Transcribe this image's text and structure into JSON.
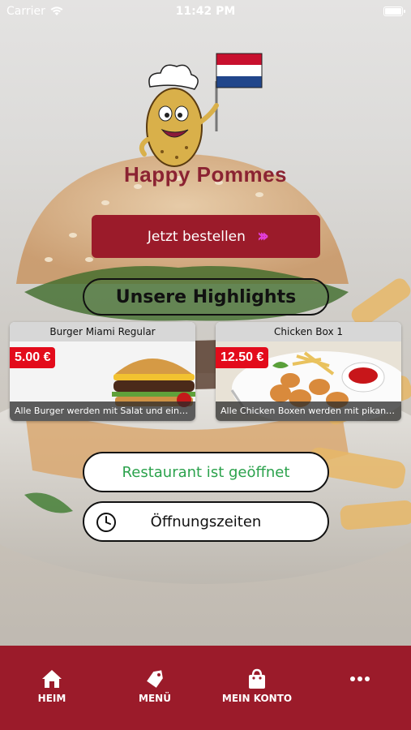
{
  "status_bar": {
    "carrier": "Carrier",
    "time": "11:42 PM"
  },
  "brand": {
    "name": "Happy Pommes"
  },
  "order_button": {
    "label": "Jetzt bestellen"
  },
  "highlights": {
    "label": "Unsere Highlights"
  },
  "cards": [
    {
      "title": "Burger Miami Regular",
      "price": "5.00 €",
      "description": "Alle Burger werden mit Salat und einer ..."
    },
    {
      "title": "Chicken Box 1",
      "price": "12.50 €",
      "description": "Alle Chicken Boxen werden mit pikanter..."
    }
  ],
  "status": {
    "label": "Restaurant ist geöffnet"
  },
  "hours": {
    "label": "Öffnungszeiten"
  },
  "tabbar": {
    "items": [
      {
        "label": "HEIM",
        "icon": "home-icon"
      },
      {
        "label": "MENÜ",
        "icon": "tag-icon"
      },
      {
        "label": "MEIN KONTO",
        "icon": "shopping-bag-icon"
      },
      {
        "label": "",
        "icon": "more-icon"
      }
    ]
  },
  "colors": {
    "primary": "#9b1b2a",
    "open": "#2ba24c",
    "price": "#e30b1b",
    "accent_arrow": "#e33fd6"
  }
}
